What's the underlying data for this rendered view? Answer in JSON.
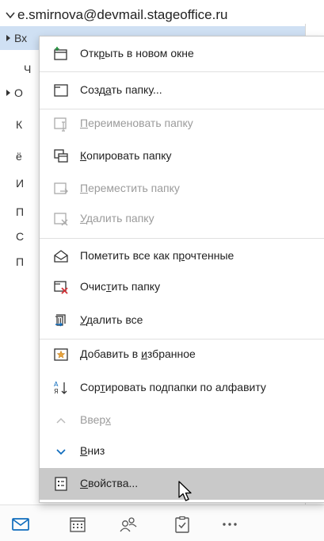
{
  "account": {
    "name": "e.smirnova@devmail.stageoffice.ru"
  },
  "folders": [
    {
      "label": "Вх",
      "expander": "collapsed",
      "selected": true
    },
    {
      "label": "Ч",
      "expander": null,
      "selected": false
    },
    {
      "label": "О",
      "expander": "collapsed",
      "selected": false
    },
    {
      "label": "К",
      "expander": null,
      "selected": false
    },
    {
      "label": "ё",
      "expander": null,
      "selected": false
    },
    {
      "label": "И",
      "expander": null,
      "selected": false
    },
    {
      "label": "П",
      "expander": null,
      "selected": false
    },
    {
      "label": "С",
      "expander": null,
      "selected": false
    },
    {
      "label": "П",
      "expander": null,
      "selected": false
    }
  ],
  "menu": {
    "items": [
      {
        "pre": "Отк",
        "key": "р",
        "post": "ыть в новом окне",
        "icon": "open-new-window-icon",
        "disabled": false
      },
      {
        "pre": "Созд",
        "key": "а",
        "post": "ть папку...",
        "icon": "new-folder-icon",
        "disabled": false
      },
      {
        "pre": "",
        "key": "П",
        "post": "ереименовать папку",
        "icon": "rename-folder-icon",
        "disabled": true
      },
      {
        "pre": "",
        "key": "К",
        "post": "опировать папку",
        "icon": "copy-folder-icon",
        "disabled": false
      },
      {
        "pre": "",
        "key": "П",
        "post": "ереместить папку",
        "icon": "move-folder-icon",
        "disabled": true
      },
      {
        "pre": "",
        "key": "У",
        "post": "далить папку",
        "icon": "delete-folder-icon",
        "disabled": true
      },
      {
        "pre": "Пометить все как п",
        "key": "р",
        "post": "очтенные",
        "icon": "mark-read-icon",
        "disabled": false
      },
      {
        "pre": "Очис",
        "key": "т",
        "post": "ить папку",
        "icon": "empty-folder-icon",
        "disabled": false
      },
      {
        "pre": "",
        "key": "У",
        "post": "далить все",
        "icon": "delete-all-icon",
        "disabled": false
      },
      {
        "pre": "Добавить в ",
        "key": "и",
        "post": "збранное",
        "icon": "add-favorite-icon",
        "disabled": false
      },
      {
        "pre": "Сор",
        "key": "т",
        "post": "ировать подпапки по алфавиту",
        "icon": "sort-az-icon",
        "disabled": false
      },
      {
        "pre": "Ввер",
        "key": "х",
        "post": "",
        "icon": "chevron-up-icon",
        "disabled": true
      },
      {
        "pre": "",
        "key": "В",
        "post": "низ",
        "icon": "chevron-down-icon",
        "disabled": false
      },
      {
        "pre": "",
        "key": "С",
        "post": "войства...",
        "icon": "properties-icon",
        "disabled": false,
        "hover": true
      }
    ]
  },
  "bottom_nav": [
    {
      "icon": "mail-icon",
      "active": true
    },
    {
      "icon": "calendar-icon",
      "active": false
    },
    {
      "icon": "people-icon",
      "active": false
    },
    {
      "icon": "tasks-icon",
      "active": false
    },
    {
      "icon": "more-icon",
      "active": false
    }
  ],
  "colors": {
    "accent": "#0f6cbd",
    "selected": "#cfe0f3",
    "hover": "#c9c9c9",
    "disabled_text": "#9b9b9b"
  }
}
